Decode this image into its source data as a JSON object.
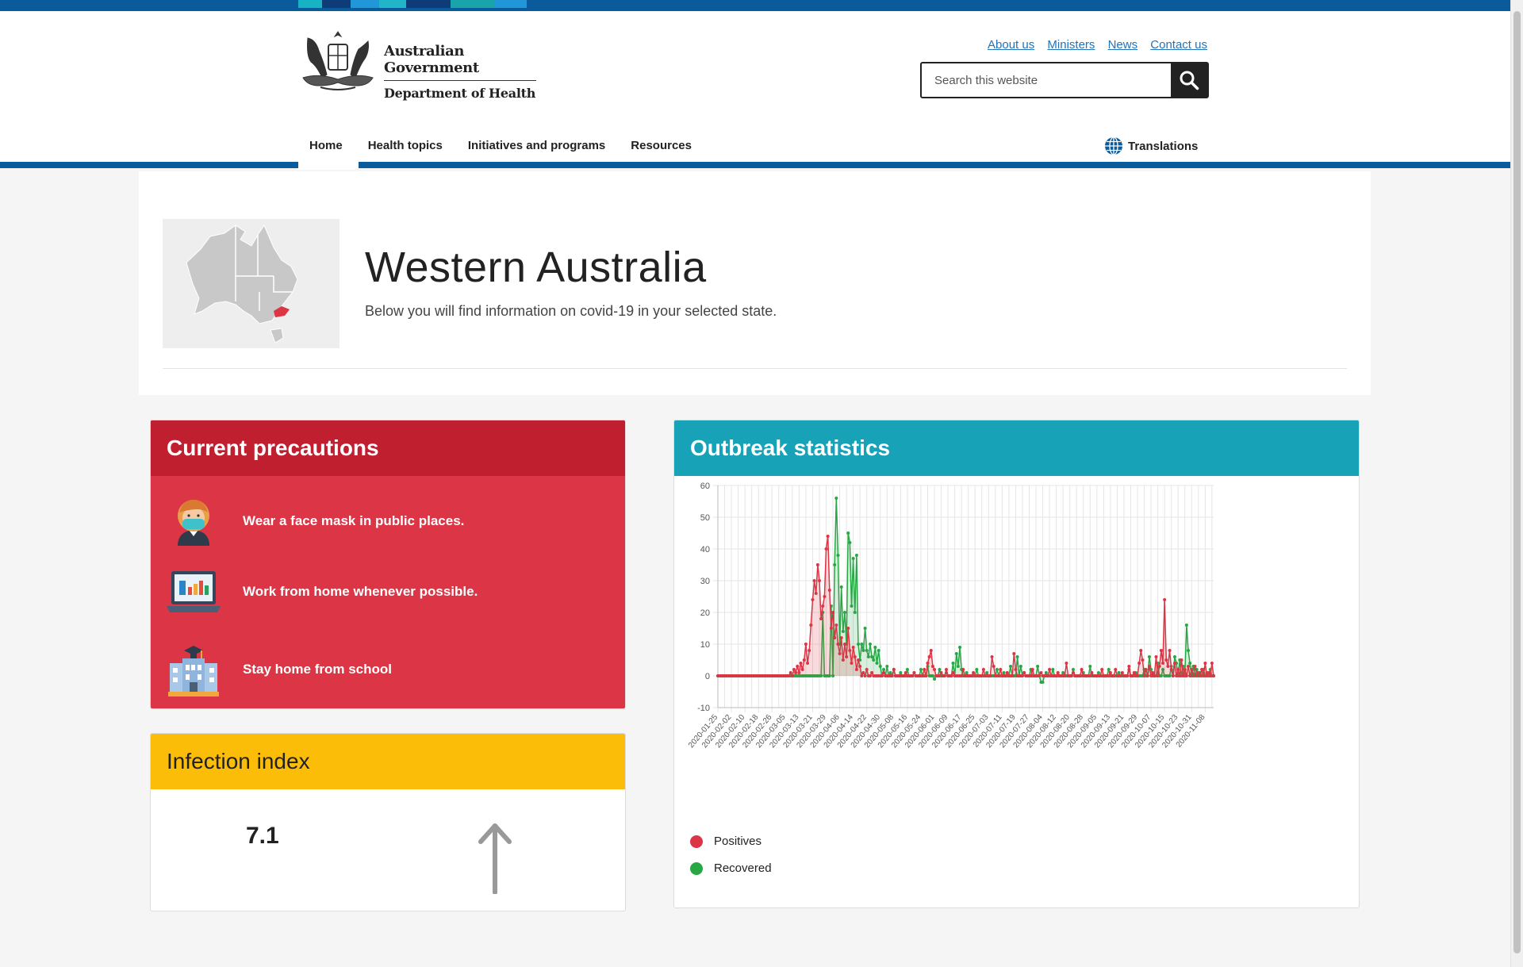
{
  "header": {
    "logo": {
      "line1": "Australian Government",
      "line2": "Department of Health"
    },
    "links": [
      "About us",
      "Ministers",
      "News",
      "Contact us"
    ],
    "search": {
      "placeholder": "Search this website",
      "button_icon": "search-icon"
    },
    "nav": [
      "Home",
      "Health topics",
      "Initiatives and programs",
      "Resources"
    ],
    "active_nav": "Home",
    "translations": "Translations"
  },
  "intro": {
    "title": "Western Australia",
    "subtitle": "Below you will find information on covid-19 in your selected state."
  },
  "precautions": {
    "title": "Current precautions",
    "items": [
      {
        "icon": "face-mask-person-icon",
        "text": "Wear a face mask in public places."
      },
      {
        "icon": "laptop-chart-icon",
        "text": "Work from home whenever possible."
      },
      {
        "icon": "school-building-icon",
        "text": "Stay home from school"
      }
    ]
  },
  "infection": {
    "title": "Infection index",
    "value": "7.1",
    "trend_icon": "arrow-up-icon"
  },
  "outbreak": {
    "title": "Outbreak statistics"
  },
  "colors": {
    "gov_blue": "#0a5b9c",
    "precautions_bg": "#dc3545",
    "precautions_head": "#bf1f2f",
    "infection_head": "#fbbd08",
    "outbreak_head": "#17a2b8",
    "positives": "#dc3545",
    "recovered": "#28a745"
  },
  "chart_data": {
    "type": "line",
    "title": "",
    "xlabel": "",
    "ylabel": "",
    "ylim": [
      -10,
      60
    ],
    "yticks": [
      -10,
      0,
      10,
      20,
      30,
      40,
      50,
      60
    ],
    "x_start": "2020-01-25",
    "x_end": "2020-11-13",
    "x_tick_labels": [
      "2020-01-25",
      "2020-02-02",
      "2020-02-10",
      "2020-02-18",
      "2020-02-26",
      "2020-03-05",
      "2020-03-13",
      "2020-03-21",
      "2020-03-29",
      "2020-04-06",
      "2020-04-14",
      "2020-04-22",
      "2020-04-30",
      "2020-05-08",
      "2020-05-16",
      "2020-05-24",
      "2020-06-01",
      "2020-06-09",
      "2020-06-17",
      "2020-06-25",
      "2020-07-03",
      "2020-07-11",
      "2020-07-19",
      "2020-07-27",
      "2020-08-04",
      "2020-08-12",
      "2020-08-20",
      "2020-08-28",
      "2020-09-05",
      "2020-09-13",
      "2020-09-21",
      "2020-09-29",
      "2020-10-07",
      "2020-10-15",
      "2020-10-23",
      "2020-10-31",
      "2020-11-08"
    ],
    "grid": true,
    "legend_position": "bottom-left",
    "series": [
      {
        "name": "Positives",
        "color": "#dc3545",
        "points": [
          [
            "2020-03-06",
            0
          ],
          [
            "2020-03-08",
            1
          ],
          [
            "2020-03-10",
            2
          ],
          [
            "2020-03-11",
            1
          ],
          [
            "2020-03-12",
            3
          ],
          [
            "2020-03-13",
            1
          ],
          [
            "2020-03-14",
            4
          ],
          [
            "2020-03-15",
            2
          ],
          [
            "2020-03-16",
            5
          ],
          [
            "2020-03-17",
            10
          ],
          [
            "2020-03-18",
            4
          ],
          [
            "2020-03-19",
            8
          ],
          [
            "2020-03-20",
            16
          ],
          [
            "2020-03-21",
            24
          ],
          [
            "2020-03-22",
            30
          ],
          [
            "2020-03-23",
            26
          ],
          [
            "2020-03-24",
            35
          ],
          [
            "2020-03-25",
            30
          ],
          [
            "2020-03-26",
            18
          ],
          [
            "2020-03-27",
            22
          ],
          [
            "2020-03-28",
            25
          ],
          [
            "2020-03-29",
            40
          ],
          [
            "2020-03-30",
            44
          ],
          [
            "2020-03-31",
            27
          ],
          [
            "2020-04-01",
            15
          ],
          [
            "2020-04-02",
            20
          ],
          [
            "2020-04-03",
            12
          ],
          [
            "2020-04-04",
            16
          ],
          [
            "2020-04-05",
            10
          ],
          [
            "2020-04-06",
            7
          ],
          [
            "2020-04-07",
            12
          ],
          [
            "2020-04-08",
            5
          ],
          [
            "2020-04-09",
            10
          ],
          [
            "2020-04-10",
            6
          ],
          [
            "2020-04-11",
            15
          ],
          [
            "2020-04-12",
            8
          ],
          [
            "2020-04-13",
            4
          ],
          [
            "2020-04-14",
            9
          ],
          [
            "2020-04-15",
            6
          ],
          [
            "2020-04-16",
            2
          ],
          [
            "2020-04-17",
            5
          ],
          [
            "2020-04-18",
            3
          ],
          [
            "2020-04-20",
            1
          ],
          [
            "2020-04-22",
            2
          ],
          [
            "2020-04-25",
            1
          ],
          [
            "2020-04-28",
            0
          ],
          [
            "2020-05-02",
            1
          ],
          [
            "2020-05-08",
            2
          ],
          [
            "2020-05-15",
            1
          ],
          [
            "2020-05-20",
            1
          ],
          [
            "2020-05-26",
            2
          ],
          [
            "2020-05-28",
            4
          ],
          [
            "2020-05-29",
            6
          ],
          [
            "2020-05-30",
            8
          ],
          [
            "2020-05-31",
            3
          ],
          [
            "2020-06-01",
            2
          ],
          [
            "2020-06-05",
            1
          ],
          [
            "2020-06-08",
            2
          ],
          [
            "2020-06-12",
            1
          ],
          [
            "2020-06-18",
            2
          ],
          [
            "2020-06-24",
            1
          ],
          [
            "2020-06-30",
            2
          ],
          [
            "2020-07-05",
            6
          ],
          [
            "2020-07-06",
            3
          ],
          [
            "2020-07-10",
            2
          ],
          [
            "2020-07-14",
            1
          ],
          [
            "2020-07-18",
            7
          ],
          [
            "2020-07-19",
            2
          ],
          [
            "2020-07-24",
            1
          ],
          [
            "2020-07-29",
            2
          ],
          [
            "2020-08-03",
            1
          ],
          [
            "2020-08-08",
            2
          ],
          [
            "2020-08-13",
            1
          ],
          [
            "2020-08-18",
            4
          ],
          [
            "2020-08-22",
            1
          ],
          [
            "2020-08-27",
            2
          ],
          [
            "2020-09-02",
            1
          ],
          [
            "2020-09-08",
            2
          ],
          [
            "2020-09-13",
            1
          ],
          [
            "2020-09-16",
            2
          ],
          [
            "2020-09-20",
            1
          ],
          [
            "2020-09-24",
            3
          ],
          [
            "2020-09-27",
            1
          ],
          [
            "2020-09-30",
            4
          ],
          [
            "2020-10-01",
            8
          ],
          [
            "2020-10-02",
            5
          ],
          [
            "2020-10-04",
            2
          ],
          [
            "2020-10-06",
            3
          ],
          [
            "2020-10-08",
            1
          ],
          [
            "2020-10-10",
            6
          ],
          [
            "2020-10-12",
            3
          ],
          [
            "2020-10-13",
            8
          ],
          [
            "2020-10-14",
            4
          ],
          [
            "2020-10-15",
            24
          ],
          [
            "2020-10-16",
            5
          ],
          [
            "2020-10-17",
            3
          ],
          [
            "2020-10-18",
            8
          ],
          [
            "2020-10-19",
            2
          ],
          [
            "2020-10-21",
            4
          ],
          [
            "2020-10-23",
            2
          ],
          [
            "2020-10-25",
            5
          ],
          [
            "2020-10-27",
            2
          ],
          [
            "2020-10-29",
            3
          ],
          [
            "2020-10-31",
            2
          ],
          [
            "2020-11-02",
            3
          ],
          [
            "2020-11-04",
            1
          ],
          [
            "2020-11-06",
            2
          ],
          [
            "2020-11-08",
            4
          ],
          [
            "2020-11-10",
            1
          ],
          [
            "2020-11-12",
            4
          ]
        ]
      },
      {
        "name": "Recovered",
        "color": "#28a745",
        "points": [
          [
            "2020-03-06",
            0
          ],
          [
            "2020-03-25",
            0
          ],
          [
            "2020-03-27",
            20
          ],
          [
            "2020-03-28",
            0
          ],
          [
            "2020-04-01",
            22
          ],
          [
            "2020-04-02",
            0
          ],
          [
            "2020-04-03",
            35
          ],
          [
            "2020-04-04",
            56
          ],
          [
            "2020-04-05",
            38
          ],
          [
            "2020-04-06",
            10
          ],
          [
            "2020-04-07",
            28
          ],
          [
            "2020-04-08",
            14
          ],
          [
            "2020-04-09",
            20
          ],
          [
            "2020-04-10",
            10
          ],
          [
            "2020-04-11",
            45
          ],
          [
            "2020-04-12",
            42
          ],
          [
            "2020-04-13",
            22
          ],
          [
            "2020-04-14",
            37
          ],
          [
            "2020-04-15",
            20
          ],
          [
            "2020-04-16",
            38
          ],
          [
            "2020-04-17",
            10
          ],
          [
            "2020-04-18",
            5
          ],
          [
            "2020-04-19",
            10
          ],
          [
            "2020-04-20",
            8
          ],
          [
            "2020-04-21",
            15
          ],
          [
            "2020-04-22",
            8
          ],
          [
            "2020-04-23",
            6
          ],
          [
            "2020-04-24",
            10
          ],
          [
            "2020-04-25",
            6
          ],
          [
            "2020-04-26",
            5
          ],
          [
            "2020-04-27",
            9
          ],
          [
            "2020-04-28",
            4
          ],
          [
            "2020-04-29",
            8
          ],
          [
            "2020-04-30",
            3
          ],
          [
            "2020-05-02",
            2
          ],
          [
            "2020-05-04",
            3
          ],
          [
            "2020-05-06",
            1
          ],
          [
            "2020-05-08",
            2
          ],
          [
            "2020-05-12",
            1
          ],
          [
            "2020-05-16",
            2
          ],
          [
            "2020-05-20",
            1
          ],
          [
            "2020-05-24",
            2
          ],
          [
            "2020-05-28",
            3
          ],
          [
            "2020-06-01",
            -1
          ],
          [
            "2020-06-04",
            2
          ],
          [
            "2020-06-08",
            1
          ],
          [
            "2020-06-12",
            4
          ],
          [
            "2020-06-14",
            7
          ],
          [
            "2020-06-15",
            3
          ],
          [
            "2020-06-16",
            9
          ],
          [
            "2020-06-17",
            2
          ],
          [
            "2020-06-20",
            1
          ],
          [
            "2020-06-26",
            2
          ],
          [
            "2020-07-02",
            1
          ],
          [
            "2020-07-08",
            2
          ],
          [
            "2020-07-12",
            1
          ],
          [
            "2020-07-16",
            3
          ],
          [
            "2020-07-20",
            6
          ],
          [
            "2020-07-22",
            3
          ],
          [
            "2020-07-24",
            1
          ],
          [
            "2020-07-28",
            2
          ],
          [
            "2020-08-01",
            3
          ],
          [
            "2020-08-03",
            -2
          ],
          [
            "2020-08-04",
            -2
          ],
          [
            "2020-08-06",
            1
          ],
          [
            "2020-08-10",
            2
          ],
          [
            "2020-08-16",
            1
          ],
          [
            "2020-08-22",
            2
          ],
          [
            "2020-08-28",
            1
          ],
          [
            "2020-09-01",
            3
          ],
          [
            "2020-09-06",
            1
          ],
          [
            "2020-09-12",
            2
          ],
          [
            "2020-09-18",
            1
          ],
          [
            "2020-09-24",
            2
          ],
          [
            "2020-09-28",
            1
          ],
          [
            "2020-10-03",
            2
          ],
          [
            "2020-10-06",
            6
          ],
          [
            "2020-10-07",
            2
          ],
          [
            "2020-10-11",
            4
          ],
          [
            "2020-10-14",
            2
          ],
          [
            "2020-10-19",
            3
          ],
          [
            "2020-10-21",
            6
          ],
          [
            "2020-10-22",
            4
          ],
          [
            "2020-10-24",
            5
          ],
          [
            "2020-10-26",
            3
          ],
          [
            "2020-10-28",
            16
          ],
          [
            "2020-10-29",
            8
          ],
          [
            "2020-10-30",
            4
          ],
          [
            "2020-11-01",
            3
          ],
          [
            "2020-11-03",
            2
          ],
          [
            "2020-11-05",
            1
          ],
          [
            "2020-11-07",
            2
          ],
          [
            "2020-11-09",
            1
          ],
          [
            "2020-11-11",
            2
          ]
        ]
      }
    ]
  }
}
